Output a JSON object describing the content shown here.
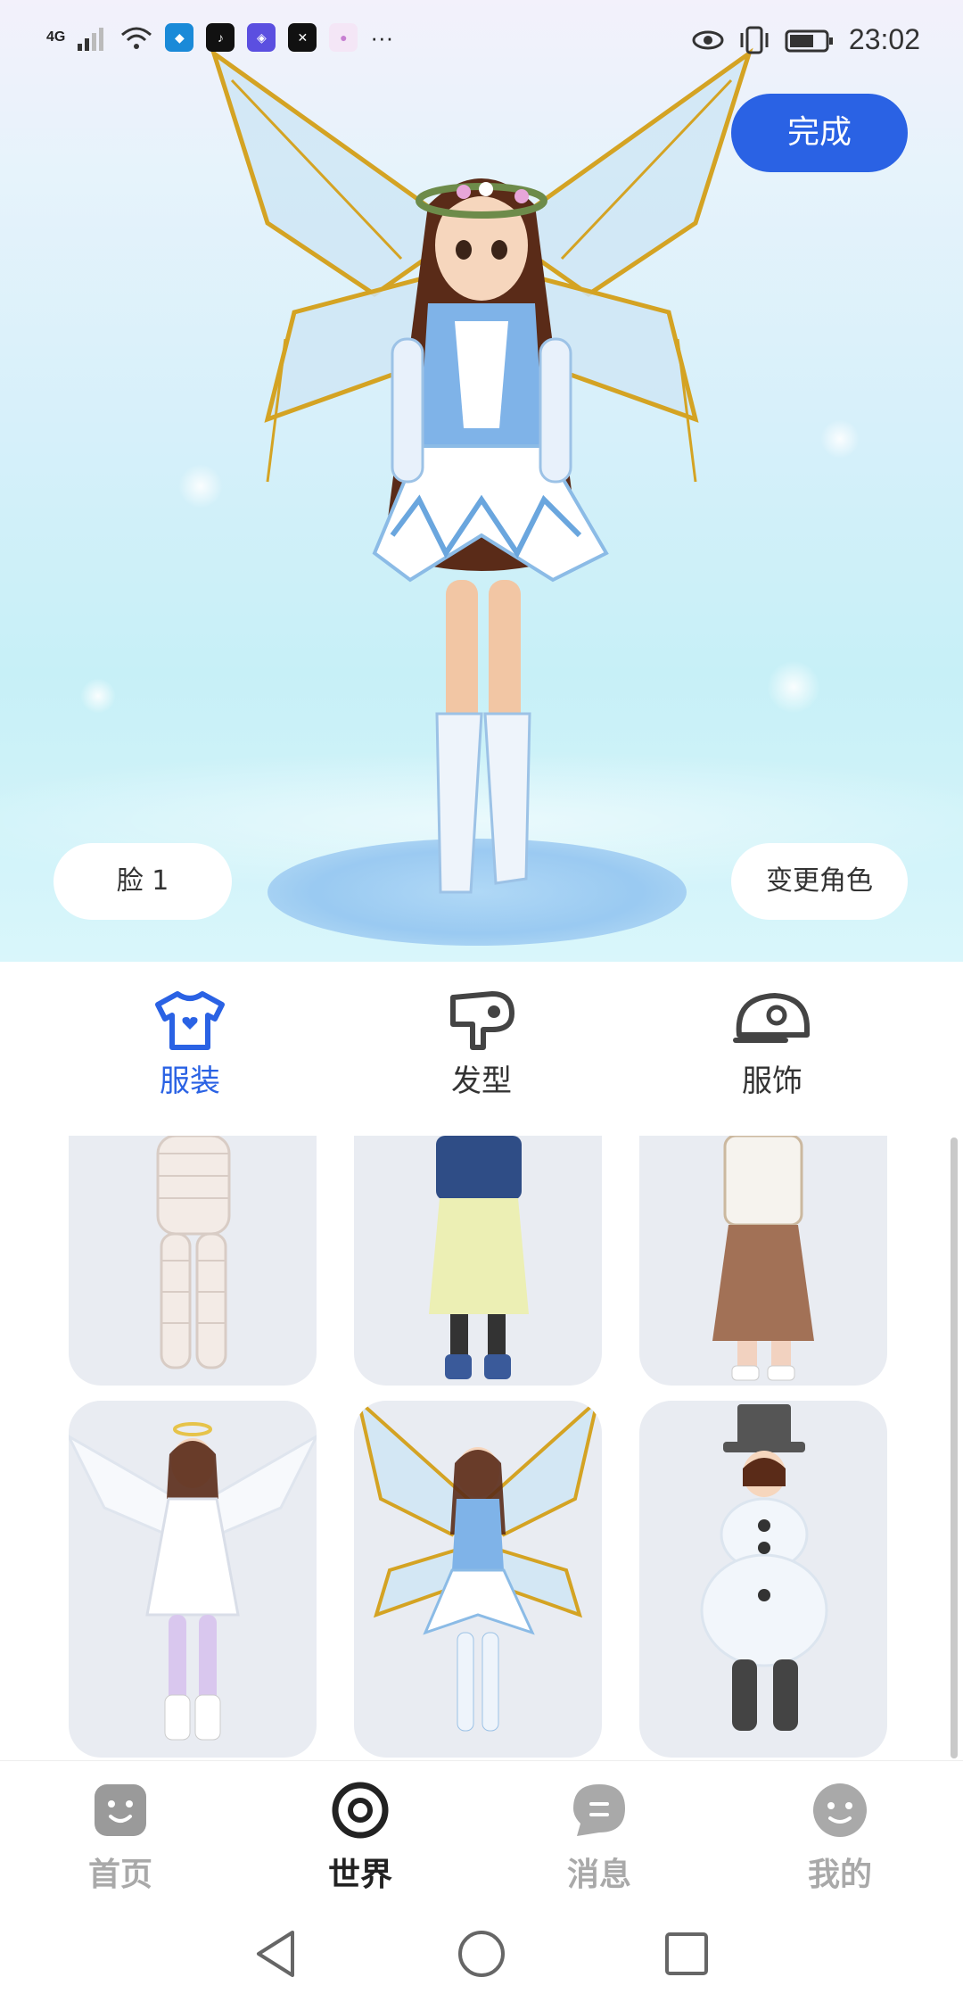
{
  "status_bar": {
    "network": "4G",
    "time": "23:02",
    "more": "···"
  },
  "preview": {
    "done_label": "完成",
    "face_label": "脸 1",
    "change_role_label": "变更角色"
  },
  "tabs": [
    {
      "label": "服装",
      "icon": "tshirt-icon",
      "active": true
    },
    {
      "label": "发型",
      "icon": "hairdryer-icon",
      "active": false
    },
    {
      "label": "服饰",
      "icon": "cap-icon",
      "active": false
    }
  ],
  "outfits": [
    {
      "name": "bandage-outfit"
    },
    {
      "name": "denim-jacket-outfit"
    },
    {
      "name": "qipao-skirt-outfit"
    },
    {
      "name": "angel-outfit"
    },
    {
      "name": "fairy-outfit"
    },
    {
      "name": "snowman-outfit"
    }
  ],
  "bottom_nav": [
    {
      "label": "首页",
      "icon": "home-face-icon",
      "active": false
    },
    {
      "label": "世界",
      "icon": "world-ring-icon",
      "active": true
    },
    {
      "label": "消息",
      "icon": "message-bubble-icon",
      "active": false
    },
    {
      "label": "我的",
      "icon": "profile-smile-icon",
      "active": false
    }
  ],
  "colors": {
    "accent": "#2a62e4",
    "card_bg": "#e9ecf2",
    "inactive_nav": "#a9a9a9"
  }
}
